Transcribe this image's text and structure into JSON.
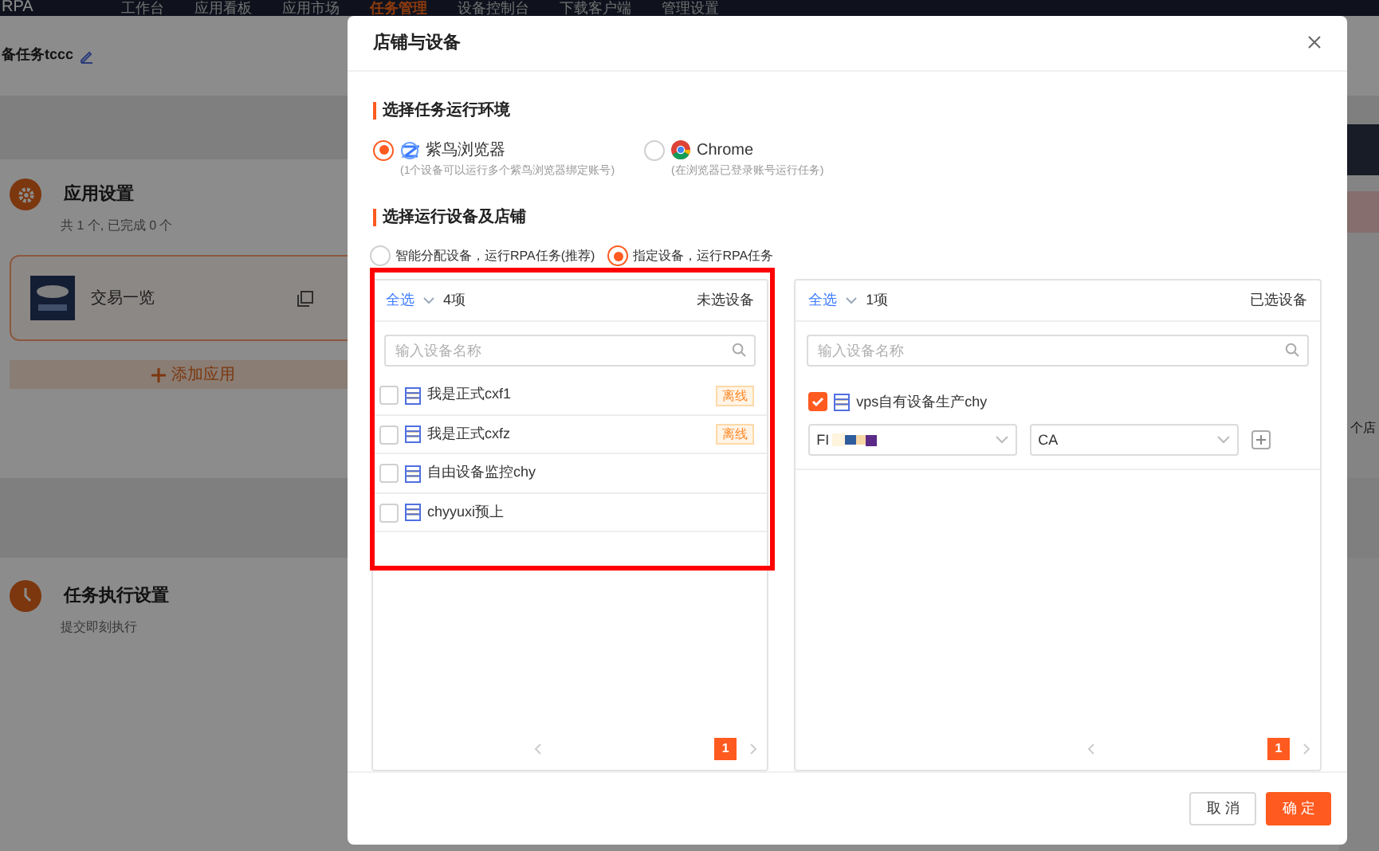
{
  "nav": {
    "logo": "RPA",
    "items": [
      {
        "label": "工作台",
        "selected": false
      },
      {
        "label": "应用看板",
        "selected": false
      },
      {
        "label": "应用市场",
        "selected": false
      },
      {
        "label": "任务管理",
        "selected": true
      },
      {
        "label": "设备控制台",
        "selected": false
      },
      {
        "label": "下载客户端",
        "selected": false
      },
      {
        "label": "管理设置",
        "selected": false
      }
    ]
  },
  "page": {
    "task_name": "备任务tccc",
    "app_section": {
      "title": "应用设置",
      "summary": "共 1 个, 已完成 0 个",
      "app": {
        "name": "交易一览"
      },
      "add_button": "添加应用"
    },
    "exec_section": {
      "title": "任务执行设置",
      "summary": "提交即刻执行"
    },
    "side_text": "个店"
  },
  "modal": {
    "title": "店铺与设备",
    "env_title": "选择任务运行环境",
    "envs": [
      {
        "kind": "ziniao",
        "label": "紫鸟浏览器",
        "hint": "(1个设备可以运行多个紫鸟浏览器绑定账号)",
        "selected": true
      },
      {
        "kind": "chrome",
        "label": "Chrome",
        "hint": "(在浏览器已登录账号运行任务)",
        "selected": false
      }
    ],
    "device_title": "选择运行设备及店铺",
    "modes": [
      {
        "label": "智能分配设备，运行RPA任务(推荐)",
        "selected": false
      },
      {
        "label": "指定设备，运行RPA任务",
        "selected": true
      }
    ],
    "panels": [
      {
        "kind": "source",
        "select_all": "全选",
        "count": "4项",
        "title": "未选设备",
        "placeholder": "输入设备名称",
        "highlighted": true,
        "page": "1",
        "items": [
          {
            "name": "我是正式cxf1",
            "checked": false,
            "tag": "离线"
          },
          {
            "name": "我是正式cxfz",
            "checked": false,
            "tag": "离线"
          },
          {
            "name": "自由设备监控chy",
            "checked": false
          },
          {
            "name": "chyyuxi预上",
            "checked": false
          }
        ]
      },
      {
        "kind": "target",
        "select_all": "全选",
        "count": "1项",
        "title": "已选设备",
        "placeholder": "输入设备名称",
        "highlighted": false,
        "page": "1",
        "items": [
          {
            "name": "vps自有设备生产chy",
            "checked": true,
            "store": "FI",
            "site": "CA"
          }
        ]
      }
    ],
    "cancel": "取 消",
    "ok": "确 定"
  }
}
